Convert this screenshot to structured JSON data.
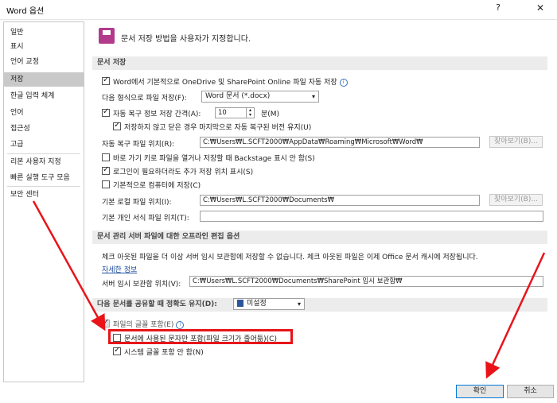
{
  "window": {
    "title": "Word 옵션",
    "help": "?",
    "close": "✕"
  },
  "sidebar": {
    "items": [
      "일반",
      "표시",
      "언어 교정",
      "저장",
      "한글 입력 체계",
      "언어",
      "접근성",
      "고급",
      "리본 사용자 지정",
      "빠른 실행 도구 모음",
      "보안 센터"
    ],
    "active": "저장"
  },
  "header": {
    "text": "문서 저장 방법을 사용자가 지정합니다."
  },
  "save_section": {
    "title": "문서 저장",
    "autosave_onedrive": "Word에서 기본적으로 OneDrive 및 SharePoint Online 파일 자동 저장",
    "format_label": "다음 형식으로 파일 저장(F):",
    "format_value": "Word 문서 (*.docx)",
    "autorecover_label": "자동 복구 정보 저장 간격(A):",
    "autorecover_value": "10",
    "autorecover_unit": "분(M)",
    "keep_last": "저장하지 않고 닫은 경우 마지막으로 자동 복구된 버전 유지(U)",
    "autorecover_path_label": "자동 복구 파일 위치(R):",
    "autorecover_path": "C:₩Users₩L.SCFT2000₩AppData₩Roaming₩Microsoft₩Word₩",
    "browse1": "찾아보기(B)...",
    "backstage": "바로 가기 키로 파일을 열거나 저장할 때 Backstage 표시 안 함(S)",
    "show_more": "로그인이 필요하더라도 추가 저장 위치 표시(S)",
    "default_computer": "기본적으로 컴퓨터에 저장(C)",
    "local_path_label": "기본 로컬 파일 위치(I):",
    "local_path": "C:₩Users₩L.SCFT2000₩Documents₩",
    "browse2": "찾아보기(B)...",
    "template_label": "기본 개인 서식 파일 위치(T):"
  },
  "offline_section": {
    "title": "문서 관리 서버 파일에 대한 오프라인 편집 옵션",
    "desc": "체크 아웃된 파일을 더 이상 서버 임시 보관함에 저장할 수 없습니다. 체크 아웃된 파일은 이제 Office 문서 캐시에 저장됩니다.",
    "link": "자세한 정보",
    "drafts_label": "서버 임시 보관함 위치(V):",
    "drafts_path": "C:₩Users₩L.SCFT2000₩Documents₩SharePoint 임시 보관함₩"
  },
  "share_section": {
    "title": "다음 문서를 공유할 때 정확도 유지(D):",
    "doc_value": "미설정",
    "embed_fonts": "파일의 글꼴 포함(E)",
    "embed_used_only": "문서에 사용된 문자만 포함(파일 크기가 줄어듦)(C)",
    "no_system_fonts": "시스템 글꼴 포함 안 함(N)"
  },
  "footer": {
    "ok": "확인",
    "cancel": "취소"
  },
  "colors": {
    "accent": "#0078d7",
    "highlight": "#e8141a",
    "header_icon": "#b23b8c"
  }
}
